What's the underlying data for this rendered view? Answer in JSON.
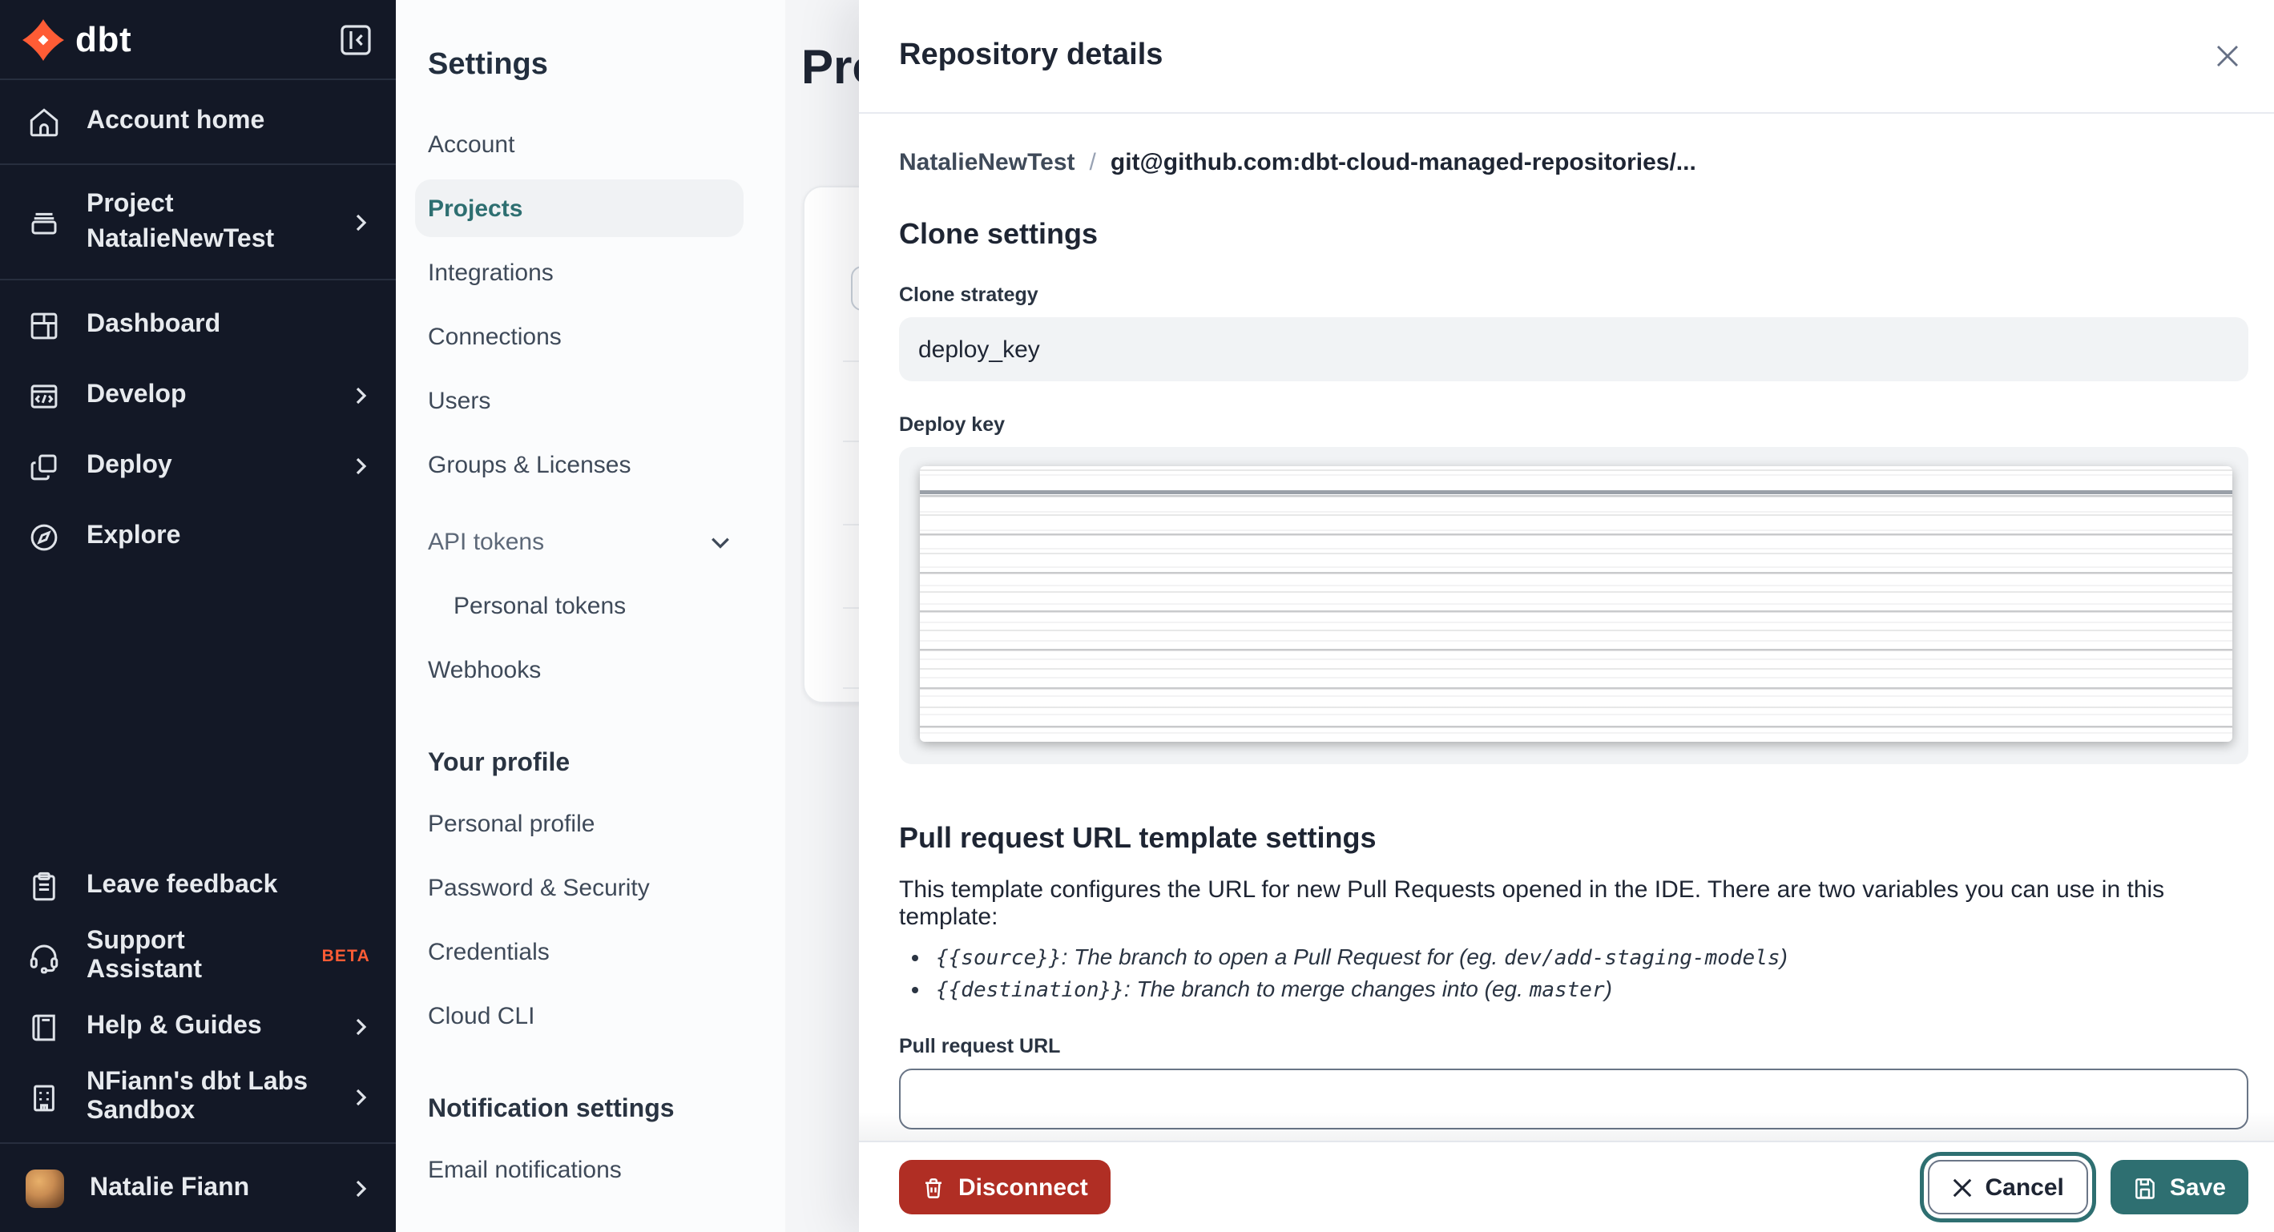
{
  "sidebar": {
    "logo_text": "dbt",
    "items": [
      {
        "label": "Account home"
      },
      {
        "label_line1": "Project",
        "label_line2": "NatalieNewTest"
      },
      {
        "label": "Dashboard"
      },
      {
        "label": "Develop"
      },
      {
        "label": "Deploy"
      },
      {
        "label": "Explore"
      }
    ],
    "footer_items": [
      {
        "label": "Leave feedback"
      },
      {
        "label": "Support Assistant",
        "badge": "BETA"
      },
      {
        "label": "Help & Guides"
      },
      {
        "label": "NFiann's dbt Labs Sandbox"
      },
      {
        "label": "Natalie Fiann"
      }
    ]
  },
  "settings_nav": {
    "title": "Settings",
    "items": [
      "Account",
      "Projects",
      "Integrations",
      "Connections",
      "Users",
      "Groups & Licenses",
      "API tokens",
      "Personal tokens",
      "Webhooks"
    ],
    "profile_heading": "Your profile",
    "profile_items": [
      "Personal profile",
      "Password & Security",
      "Credentials",
      "Cloud CLI"
    ],
    "notification_heading": "Notification settings",
    "notification_items": [
      "Email notifications"
    ]
  },
  "main": {
    "page_title": "Projects"
  },
  "modal": {
    "title": "Repository details",
    "breadcrumb": {
      "project": "NatalieNewTest",
      "separator": "/",
      "repo": "git@github.com:dbt-cloud-managed-repositories/..."
    },
    "clone": {
      "heading": "Clone settings",
      "strategy_label": "Clone strategy",
      "strategy_value": "deploy_key",
      "deploy_key_label": "Deploy key"
    },
    "pr": {
      "heading": "Pull request URL template settings",
      "description": "This template configures the URL for new Pull Requests opened in the IDE. There are two variables you can use in this template:",
      "bullets": [
        {
          "code": "{{source}}",
          "mid": ": The branch to open a Pull Request for (eg. ",
          "eg": "dev/add-staging-models",
          "end": ")"
        },
        {
          "code": "{{destination}}",
          "mid": ": The branch to merge changes into (eg. ",
          "eg": "master",
          "end": ")"
        }
      ],
      "url_label": "Pull request URL",
      "url_value": ""
    },
    "footer": {
      "disconnect_label": "Disconnect",
      "cancel_label": "Cancel",
      "save_label": "Save"
    }
  },
  "colors": {
    "accent_teal": "#2e6f71",
    "danger_red": "#b02e24",
    "brand_orange": "#ff5c35",
    "sidebar_bg": "#131826"
  }
}
